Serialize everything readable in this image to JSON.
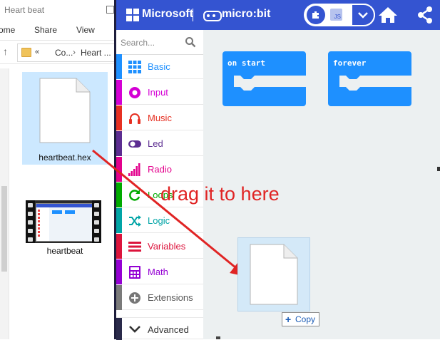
{
  "explorer": {
    "title": "Heart beat",
    "ribbon": {
      "tab_home": "ome",
      "tab_share": "Share",
      "tab_view": "View"
    },
    "up_arrow": "↑",
    "breadcrumb": {
      "chevrons": "«",
      "part1": "Co...",
      "sep": "›",
      "part2": "Heart ..."
    },
    "files": [
      {
        "name": "heartbeat.hex",
        "icon": "document-icon",
        "selected": true
      },
      {
        "name": "heartbeat",
        "icon": "video-thumbnail-icon",
        "selected": false
      }
    ]
  },
  "makecode": {
    "header": {
      "brand": "Microsoft",
      "product": "micro:bit",
      "editor_toggle": {
        "blocks_icon": "puzzle-icon",
        "js_label": "JS",
        "dropdown_icon": "chevron-down-icon"
      },
      "home_icon": "home-icon",
      "share_icon": "share-icon",
      "color": "#3454d1"
    },
    "toolbox": {
      "search_placeholder": "Search...",
      "categories": [
        {
          "label": "Basic",
          "color": "#1e90ff",
          "icon": "grid-icon"
        },
        {
          "label": "Input",
          "color": "#d400d4",
          "icon": "target-icon"
        },
        {
          "label": "Music",
          "color": "#e63022",
          "icon": "headphones-icon"
        },
        {
          "label": "Led",
          "color": "#5c2d91",
          "icon": "toggle-icon"
        },
        {
          "label": "Radio",
          "color": "#e3008c",
          "icon": "signal-bars-icon"
        },
        {
          "label": "Loops",
          "color": "#00aa00",
          "icon": "loop-arrow-icon"
        },
        {
          "label": "Logic",
          "color": "#00a4a6",
          "icon": "shuffle-icon"
        },
        {
          "label": "Variables",
          "color": "#dc143c",
          "icon": "list-icon"
        },
        {
          "label": "Math",
          "color": "#9400d3",
          "icon": "calculator-icon"
        },
        {
          "label": "Extensions",
          "color": "#7a7a7a",
          "icon": "plus-circle-icon"
        },
        {
          "label": "Advanced",
          "color": "#2a2a4a",
          "icon": "chevron-down-icon"
        }
      ]
    },
    "workspace": {
      "block_color": "#1e90ff",
      "blocks": [
        {
          "label": "on start"
        },
        {
          "label": "forever"
        }
      ]
    }
  },
  "overlay": {
    "annotation": "drag it to here",
    "annotation_color": "#e02424",
    "copy_tooltip": {
      "plus": "+",
      "label": "Copy"
    }
  }
}
